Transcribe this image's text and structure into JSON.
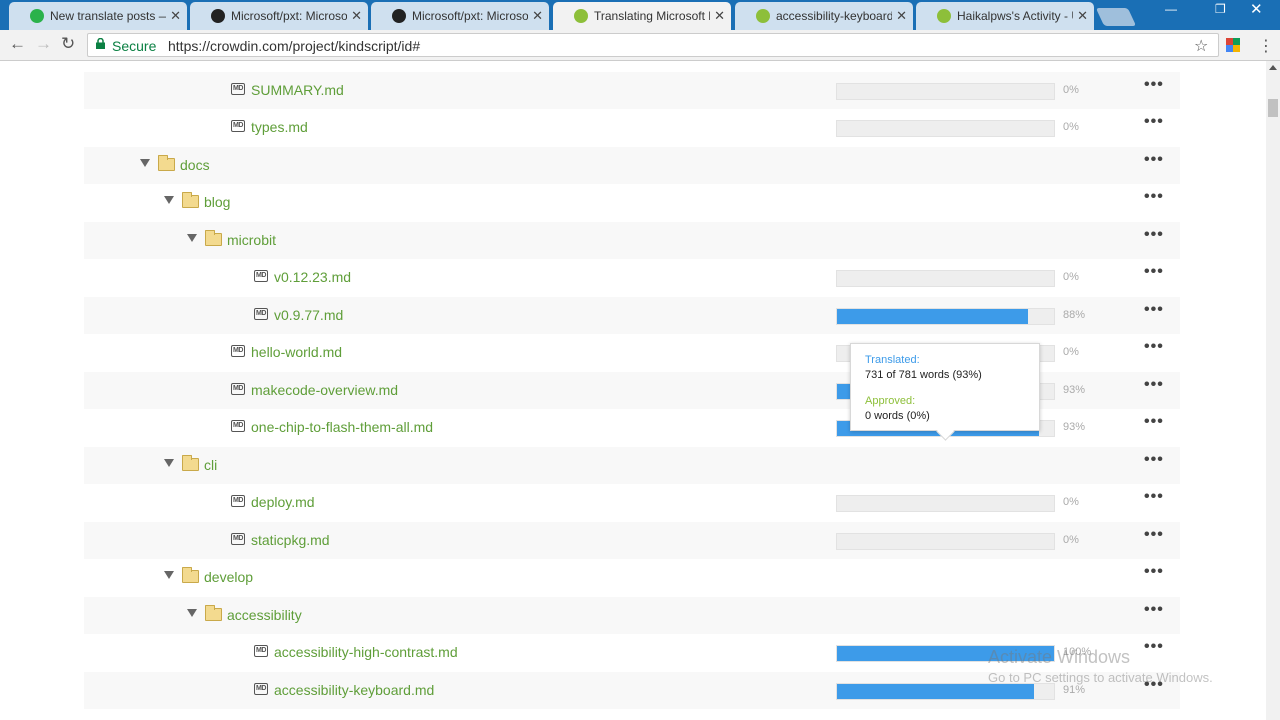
{
  "browser": {
    "tabs": [
      {
        "title": "New translate posts — S",
        "favicon": "discourse-icon",
        "color": "#2ab24b"
      },
      {
        "title": "Microsoft/pxt: Microsoft",
        "favicon": "github-icon",
        "color": "#222222"
      },
      {
        "title": "Microsoft/pxt: Microsoft",
        "favicon": "github-icon",
        "color": "#222222"
      },
      {
        "title": "Translating Microsoft Ma",
        "favicon": "crowdin-icon",
        "color": "#8dbf3a"
      },
      {
        "title": "accessibility-keyboard.m",
        "favicon": "crowdin-icon",
        "color": "#8dbf3a"
      },
      {
        "title": "Haikalpws's Activity - Us",
        "favicon": "crowdin-icon",
        "color": "#8dbf3a"
      }
    ],
    "active_tab": 3,
    "secure_label": "Secure",
    "url": "https://crowdin.com/project/kindscript/id#"
  },
  "tree": [
    {
      "type": "file",
      "name": "SUMMARY.md",
      "progress": 0,
      "percent": "0%"
    },
    {
      "type": "file",
      "name": "types.md",
      "progress": 0,
      "percent": "0%"
    },
    {
      "type": "folder",
      "name": "docs"
    },
    {
      "type": "folder",
      "name": "blog"
    },
    {
      "type": "folder",
      "name": "microbit"
    },
    {
      "type": "file",
      "name": "v0.12.23.md",
      "progress": 0,
      "percent": "0%"
    },
    {
      "type": "file",
      "name": "v0.9.77.md",
      "progress": 0.88,
      "percent": "88%"
    },
    {
      "type": "file",
      "name": "hello-world.md",
      "progress": 0,
      "percent": "0%"
    },
    {
      "type": "file",
      "name": "makecode-overview.md",
      "progress": 0.93,
      "percent": "93%"
    },
    {
      "type": "file",
      "name": "one-chip-to-flash-them-all.md",
      "progress": 0.93,
      "percent": "93%"
    },
    {
      "type": "folder",
      "name": "cli"
    },
    {
      "type": "file",
      "name": "deploy.md",
      "progress": 0,
      "percent": "0%"
    },
    {
      "type": "file",
      "name": "staticpkg.md",
      "progress": 0,
      "percent": "0%"
    },
    {
      "type": "folder",
      "name": "develop"
    },
    {
      "type": "folder",
      "name": "accessibility"
    },
    {
      "type": "file",
      "name": "accessibility-high-contrast.md",
      "progress": 1.0,
      "percent": "100%"
    },
    {
      "type": "file",
      "name": "accessibility-keyboard.md",
      "progress": 0.91,
      "percent": "91%"
    }
  ],
  "tooltip": {
    "translated_label": "Translated:",
    "translated_value": "731 of 781 words (93%)",
    "approved_label": "Approved:",
    "approved_value": "0 words (0%)"
  },
  "watermark": {
    "line1": "Activate Windows",
    "line2": "Go to PC settings to activate Windows."
  },
  "colors": {
    "progress": "#3d9be9",
    "link": "#5f9e39",
    "approved": "#8dbf3a",
    "tabstrip": "#1a6fb5"
  }
}
